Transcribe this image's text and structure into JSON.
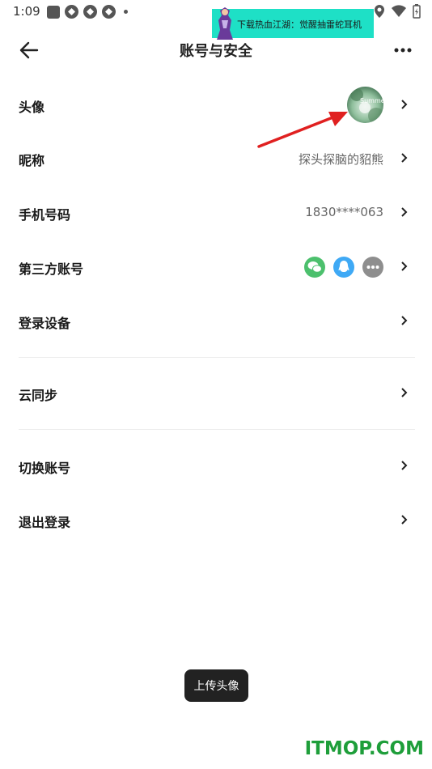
{
  "status_bar": {
    "time": "1:09"
  },
  "ad_banner": {
    "text": "下载热血江湖：觉醒抽雷蛇耳机"
  },
  "header": {
    "title": "账号与安全"
  },
  "rows": [
    {
      "label": "头像",
      "value": ""
    },
    {
      "label": "昵称",
      "value": "探头探脑的貂熊"
    },
    {
      "label": "手机号码",
      "value": "1830****063"
    },
    {
      "label": "第三方账号",
      "value": ""
    },
    {
      "label": "登录设备",
      "value": ""
    },
    {
      "label": "云同步",
      "value": ""
    },
    {
      "label": "切换账号",
      "value": ""
    },
    {
      "label": "退出登录",
      "value": ""
    }
  ],
  "avatar": {
    "overlay_text": "Summer"
  },
  "third_party_icons": [
    "wechat-icon",
    "qq-icon",
    "more-accounts-icon"
  ],
  "toast": {
    "text": "上传头像"
  },
  "watermark": {
    "text": "ITMOP.COM"
  },
  "colors": {
    "wechat": "#4cc06d",
    "qq": "#3fa9f5",
    "more": "#8e8e8e",
    "annotation_arrow": "#e02020",
    "ad_bg": "#1ee0c6",
    "watermark": "#1e9e3a"
  }
}
